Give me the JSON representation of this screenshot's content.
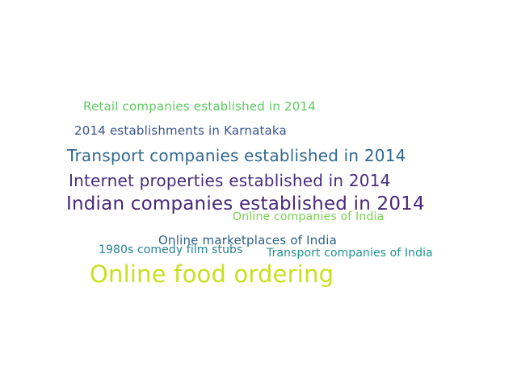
{
  "word_cloud": {
    "words": [
      {
        "key": "retail",
        "text": "Retail companies established in 2014",
        "color": "#5ec962"
      },
      {
        "key": "karnataka",
        "text": "2014 establishments in Karnataka",
        "color": "#3b528b"
      },
      {
        "key": "transport14",
        "text": "Transport companies established in 2014",
        "color": "#31688e"
      },
      {
        "key": "internet",
        "text": "Internet properties established in 2014",
        "color": "#472d7b"
      },
      {
        "key": "indian",
        "text": "Indian companies established in 2014",
        "color": "#482878"
      },
      {
        "key": "onlineco",
        "text": "Online companies of India",
        "color": "#7ad151"
      },
      {
        "key": "market",
        "text": "Online marketplaces of India",
        "color": "#2c5f8a"
      },
      {
        "key": "comedy",
        "text": "1980s comedy film stubs",
        "color": "#26828e"
      },
      {
        "key": "transportin",
        "text": "Transport companies of India",
        "color": "#21918c"
      },
      {
        "key": "food",
        "text": "Online food ordering",
        "color": "#c8e020"
      }
    ]
  }
}
